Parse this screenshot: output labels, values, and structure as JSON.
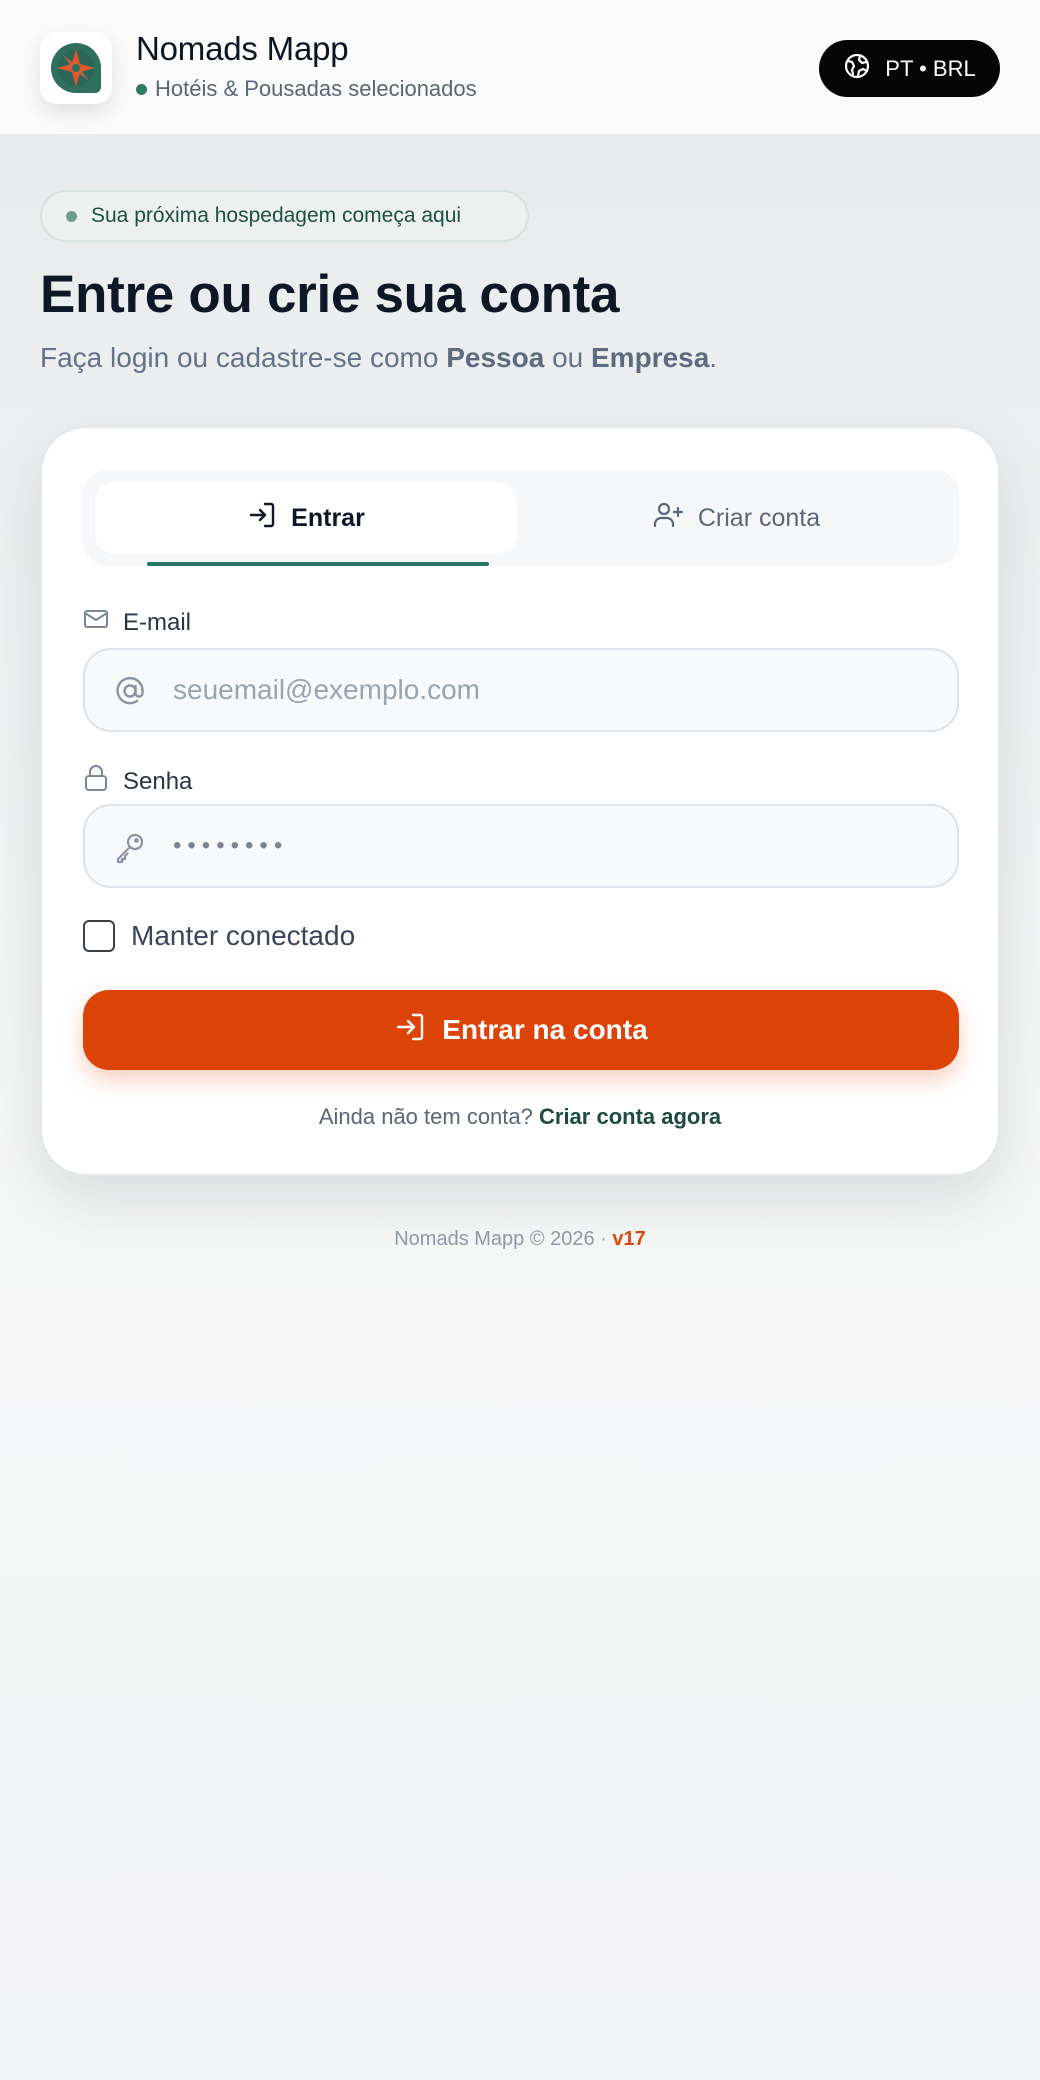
{
  "header": {
    "app_title": "Nomads Mapp",
    "app_subtitle": "Hotéis & Pousadas selecionados",
    "lang_label": "PT • BRL",
    "logo_icon": "compass-logo-icon"
  },
  "hero": {
    "badge": "Sua próxima hospedagem começa aqui",
    "title": "Entre ou crie sua conta",
    "subtitle_prefix": "Faça login ou cadastre-se como ",
    "subtitle_pessoa": "Pessoa",
    "subtitle_mid": " ou ",
    "subtitle_empresa": "Empresa",
    "subtitle_suffix": "."
  },
  "tabs": {
    "login": "Entrar",
    "signup": "Criar conta",
    "active": "login"
  },
  "form": {
    "email_label": "E-mail",
    "email_placeholder": "seuemail@exemplo.com",
    "email_value": "",
    "password_label": "Senha",
    "password_value": "••••••••",
    "remember_label": "Manter conectado",
    "remember_checked": false,
    "submit_label": "Entrar na conta",
    "signup_prompt": "Ainda não tem conta?",
    "signup_link": "Criar conta agora"
  },
  "footer": {
    "text": "Nomads Mapp © 2026 ·",
    "version": "v17"
  },
  "colors": {
    "brand_green": "#2b7461",
    "accent_orange": "#dc4307",
    "lang_pill_bg": "#050505"
  }
}
